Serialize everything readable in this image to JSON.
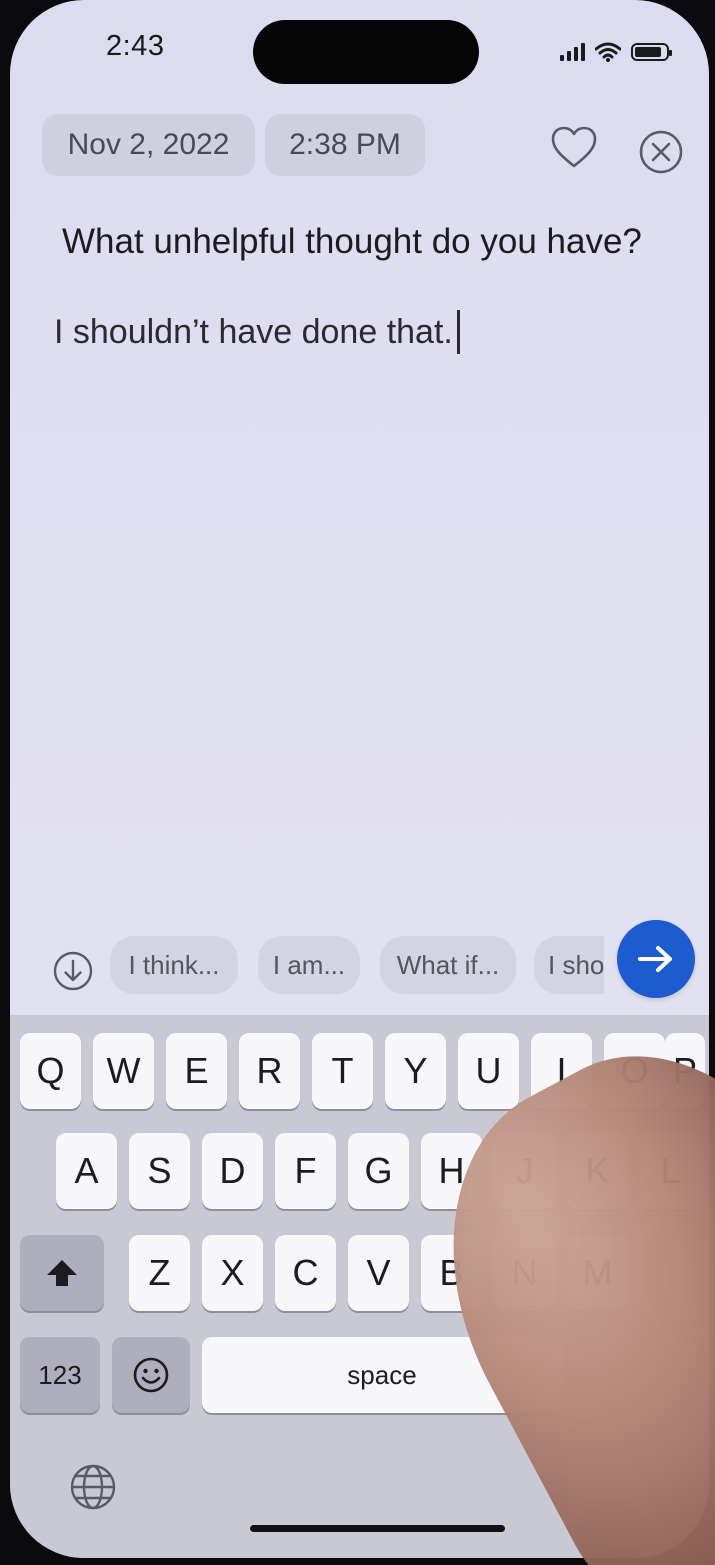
{
  "status_bar": {
    "time": "2:43",
    "battery_level": 0.85
  },
  "header": {
    "date": "Nov 2, 2022",
    "time": "2:38 PM",
    "favorite_icon": "heart-icon",
    "close_icon": "close-circle-icon"
  },
  "prompt": {
    "question": "What unhelpful thought do you have?"
  },
  "entry": {
    "value": "I shouldn’t have done that."
  },
  "suggestions": {
    "dismiss_icon": "arrow-down-circle-icon",
    "items": [
      "I think...",
      "I am...",
      "What if...",
      "I sho"
    ],
    "next_icon": "arrow-right-icon",
    "accent_color": "#1c5ccf"
  },
  "keyboard": {
    "row1": [
      "Q",
      "W",
      "E",
      "R",
      "T",
      "Y",
      "U",
      "I",
      "O",
      "P"
    ],
    "row2": [
      "A",
      "S",
      "D",
      "F",
      "G",
      "H",
      "J",
      "K",
      "L"
    ],
    "row3": [
      "Z",
      "X",
      "C",
      "V",
      "B",
      "N",
      "M"
    ],
    "numbers_label": "123",
    "space_label": "space",
    "shift_icon": "shift-icon",
    "emoji_icon": "emoji-icon",
    "globe_icon": "globe-icon"
  }
}
